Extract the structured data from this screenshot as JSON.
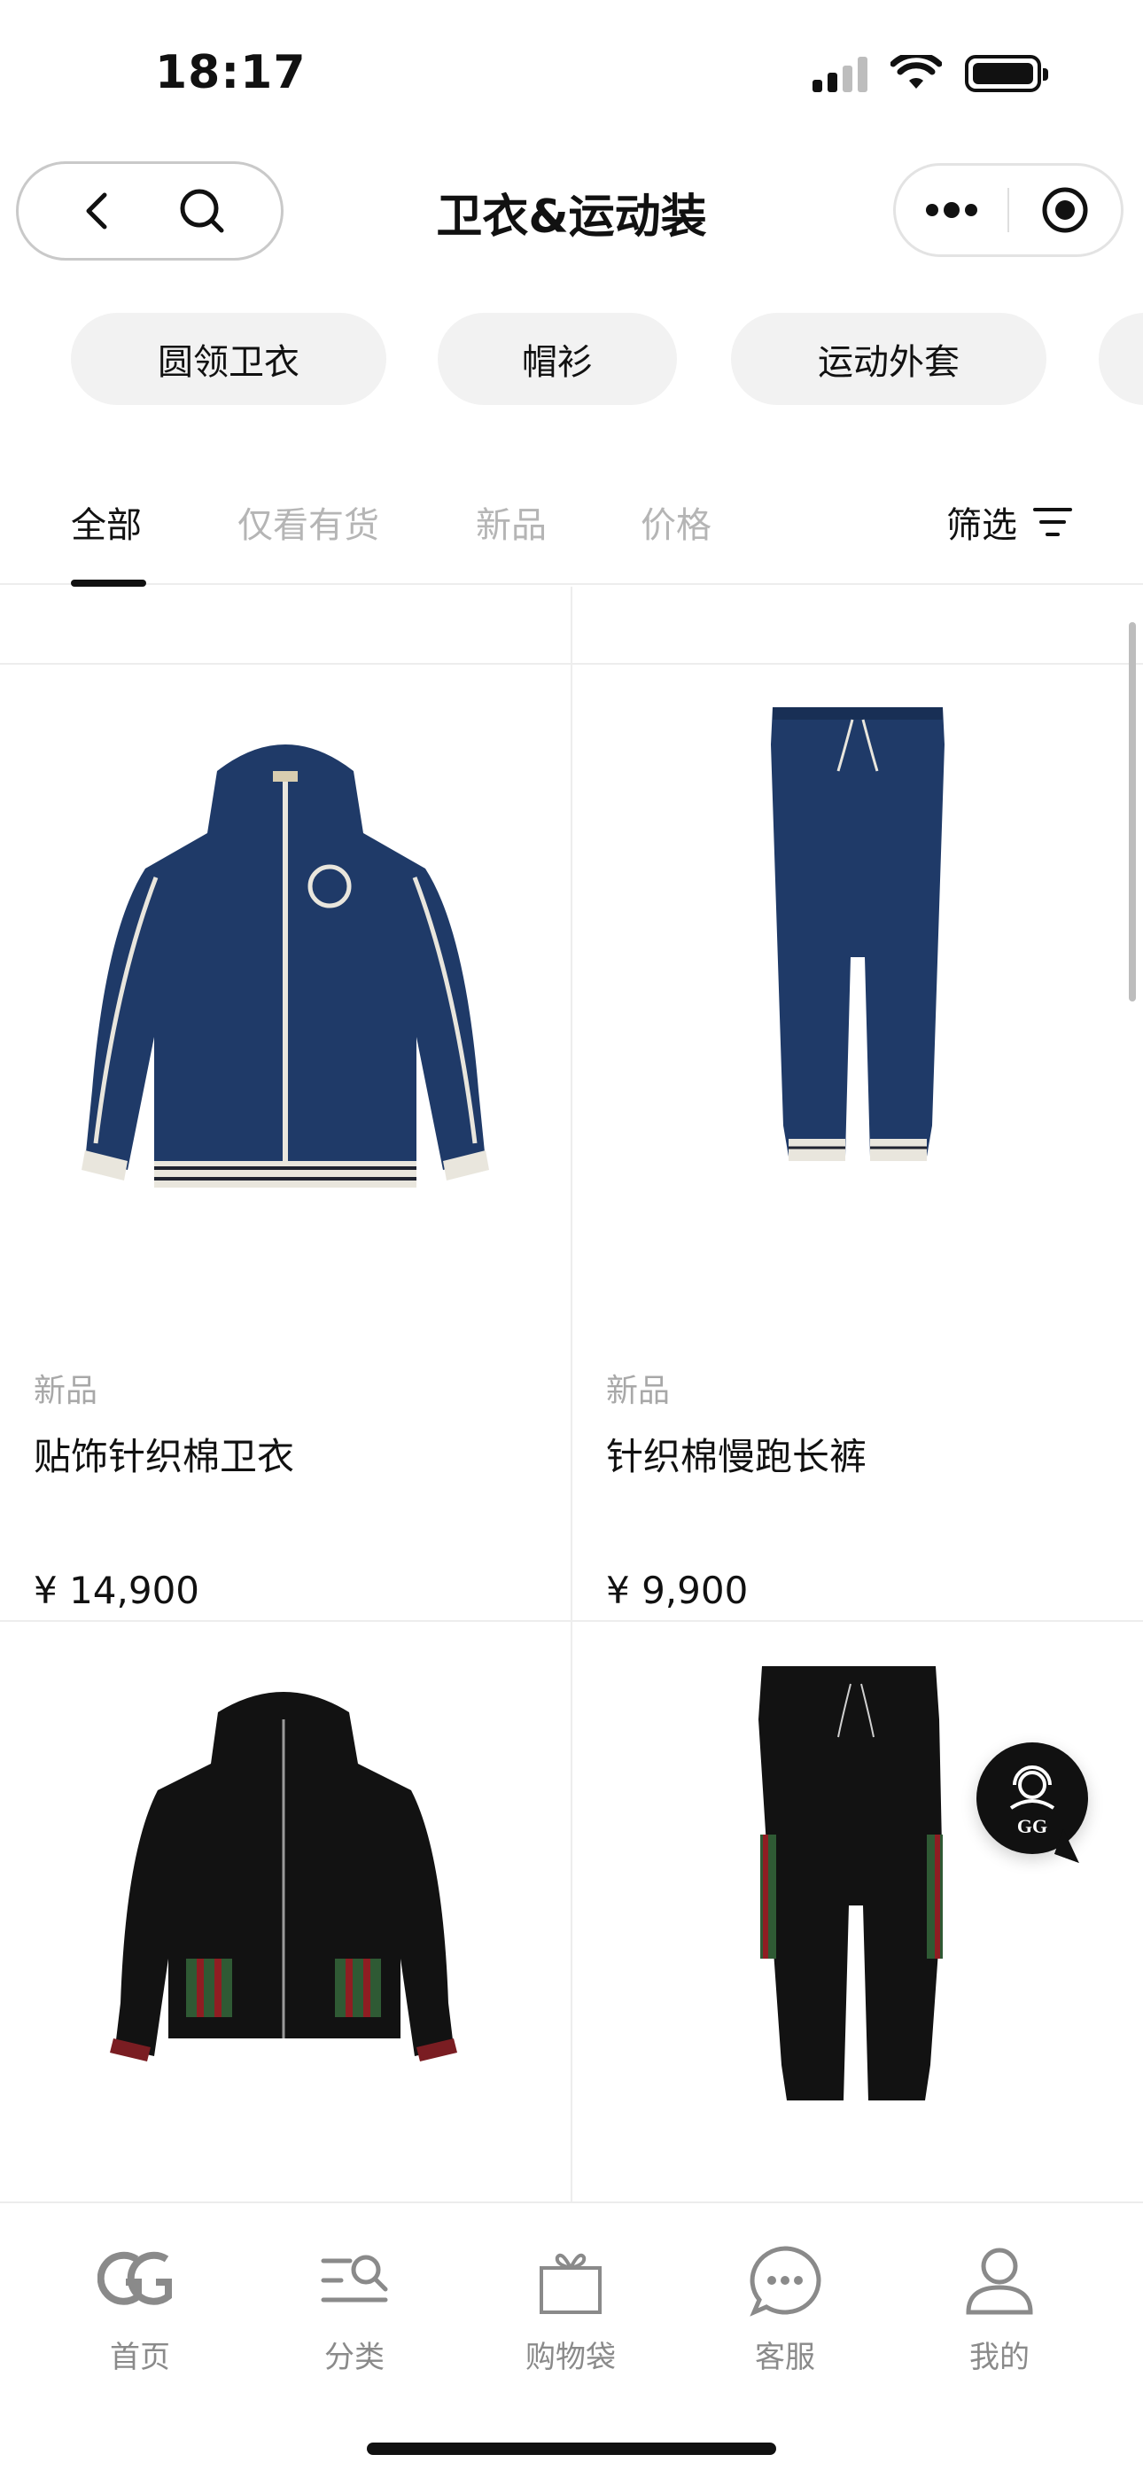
{
  "status_bar": {
    "time": "18:17"
  },
  "nav": {
    "title": "卫衣&运动装"
  },
  "categories": [
    {
      "label": "圆领卫衣"
    },
    {
      "label": "帽衫"
    },
    {
      "label": "运动外套"
    }
  ],
  "tabs": [
    {
      "label": "全部",
      "active": true
    },
    {
      "label": "仅看有货",
      "active": false
    },
    {
      "label": "新品",
      "active": false
    },
    {
      "label": "价格",
      "active": false
    }
  ],
  "filter": {
    "label": "筛选"
  },
  "products": [
    {
      "tag": "新品",
      "name": "贴饰针织棉卫衣",
      "price": "¥ 14,900",
      "color": "#1f3a68",
      "kind": "jacket-navy"
    },
    {
      "tag": "新品",
      "name": "针织棉慢跑长裤",
      "price": "¥ 9,900",
      "color": "#1f3a68",
      "kind": "pants-navy"
    },
    {
      "tag": "",
      "name": "",
      "price": "",
      "color": "#111111",
      "kind": "jacket-black"
    },
    {
      "tag": "",
      "name": "",
      "price": "",
      "color": "#111111",
      "kind": "pants-black"
    }
  ],
  "tabbar": [
    {
      "label": "首页",
      "icon": "gg-logo-icon"
    },
    {
      "label": "分类",
      "icon": "category-search-icon"
    },
    {
      "label": "购物袋",
      "icon": "shopping-bag-icon"
    },
    {
      "label": "客服",
      "icon": "chat-bubble-icon"
    },
    {
      "label": "我的",
      "icon": "user-icon"
    }
  ],
  "colors": {
    "accent": "#111111",
    "muted": "#b5b5b5",
    "chip_bg": "#f2f2f2",
    "navy": "#1f3a68"
  }
}
